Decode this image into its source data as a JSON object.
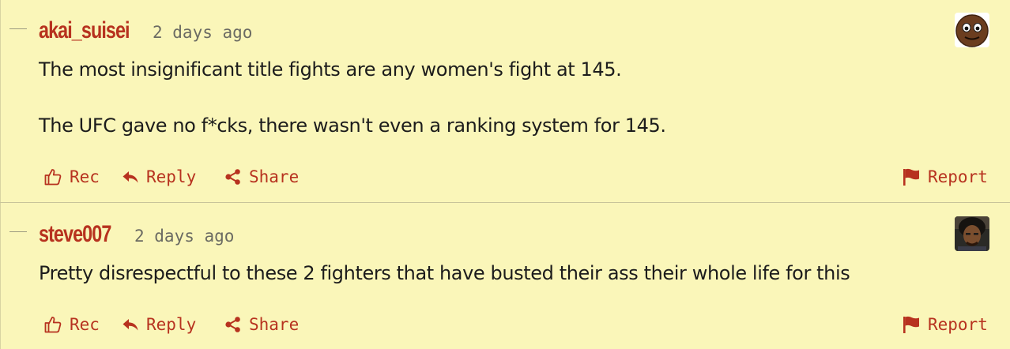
{
  "comments": [
    {
      "username": "akai_suisei",
      "timestamp": "2 days ago",
      "paragraphs": [
        "The most insignificant title fights are any women's fight at 145.",
        "The UFC gave no f*cks, there wasn't even a ranking system for 145."
      ],
      "avatar_icon": "cartoon-face-avatar",
      "actions": {
        "rec": "Rec",
        "reply": "Reply",
        "share": "Share",
        "report": "Report"
      }
    },
    {
      "username": "steve007",
      "timestamp": "2 days ago",
      "paragraphs": [
        "Pretty disrespectful to these 2 fighters that have busted their ass their whole life for this"
      ],
      "avatar_icon": "photo-portrait-avatar",
      "actions": {
        "rec": "Rec",
        "reply": "Reply",
        "share": "Share",
        "report": "Report"
      }
    }
  ],
  "colors": {
    "background": "#faf6b9",
    "accent": "#b7321f",
    "text": "#1c1c1c",
    "muted": "#6b6b63"
  }
}
